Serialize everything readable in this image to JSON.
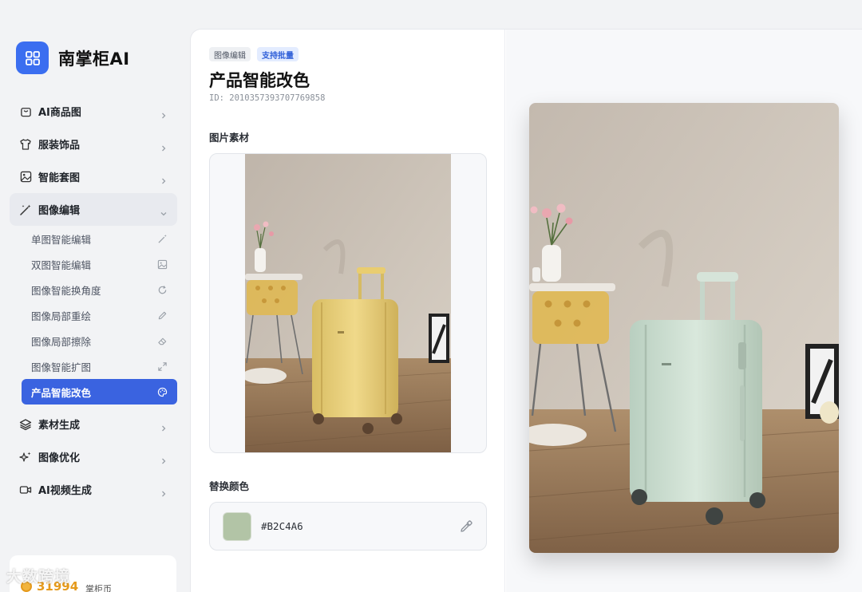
{
  "brand": {
    "name": "南掌柜AI",
    "logo_icon": "grid-icon",
    "accent": "#3b6ef0"
  },
  "nav": {
    "items": [
      {
        "label": "AI商品图",
        "icon": "bag-icon"
      },
      {
        "label": "服装饰品",
        "icon": "shirt-icon"
      },
      {
        "label": "智能套图",
        "icon": "image-icon"
      }
    ],
    "open_item": {
      "label": "图像编辑",
      "icon": "magic-wand-icon"
    },
    "sub_items": [
      {
        "label": "单图智能编辑",
        "icon": "wand-icon"
      },
      {
        "label": "双图智能编辑",
        "icon": "image-icon"
      },
      {
        "label": "图像智能换角度",
        "icon": "rotate-icon"
      },
      {
        "label": "图像局部重绘",
        "icon": "pencil-icon"
      },
      {
        "label": "图像局部擦除",
        "icon": "eraser-icon"
      },
      {
        "label": "图像智能扩图",
        "icon": "expand-icon"
      },
      {
        "label": "产品智能改色",
        "icon": "palette-icon",
        "active": true
      }
    ],
    "items_after": [
      {
        "label": "素材生成",
        "icon": "layers-icon"
      },
      {
        "label": "图像优化",
        "icon": "sparkle-icon"
      },
      {
        "label": "AI视频生成",
        "icon": "video-icon"
      }
    ]
  },
  "credits": {
    "value": "31994",
    "unit": "掌柜币"
  },
  "watermark": "大数跨境",
  "page": {
    "tags": [
      "图像编辑",
      "支持批量"
    ],
    "title": "产品智能改色",
    "id_line": "ID: 2010357393707769858",
    "source_label": "图片素材",
    "color_label": "替换颜色"
  },
  "color": {
    "hex": "#B2C4A6",
    "swatch": "#B2C4A6"
  },
  "colors": {
    "source_suitcase": "#E8CF7A",
    "result_suitcase": "#CFE0D3",
    "active_nav": "#3a63e0"
  }
}
